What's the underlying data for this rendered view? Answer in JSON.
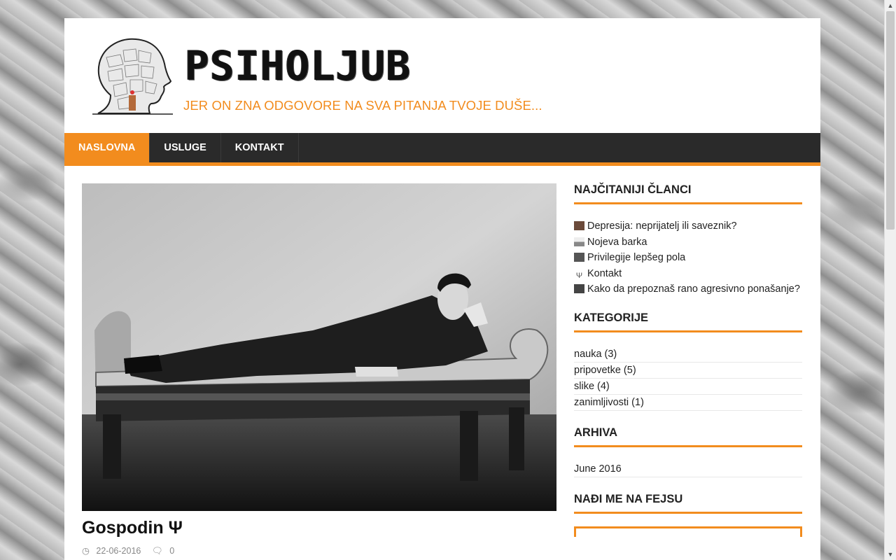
{
  "header": {
    "site_title": "PSIHOLJUB",
    "tagline": "JER ON ZNA ODGOVORE NA SVA PITANJA TVOJE DUŠE..."
  },
  "nav": {
    "items": [
      {
        "label": "NASLOVNA",
        "active": true
      },
      {
        "label": "USLUGE",
        "active": false
      },
      {
        "label": "KONTAKT",
        "active": false
      }
    ]
  },
  "post": {
    "title": "Gospodin Ψ",
    "date": "22-06-2016",
    "comments": "0",
    "icons": {
      "date": "clock-icon",
      "comments": "comment-icon"
    }
  },
  "sidebar": {
    "popular": {
      "title": "NAJČITANIJI ČLANCI",
      "items": [
        "Depresija: neprijatelj ili saveznik?",
        "Nojeva barka",
        "Privilegije lepšeg pola",
        "Kontakt",
        "Kako da prepoznaš rano agresivno ponašanje?"
      ]
    },
    "categories": {
      "title": "KATEGORIJE",
      "items": [
        "nauka (3)",
        "pripovetke (5)",
        "slike (4)",
        "zanimljivosti (1)"
      ]
    },
    "archive": {
      "title": "ARHIVA",
      "items": [
        "June 2016"
      ]
    },
    "facebook": {
      "title": "NAĐI ME NA FEJSU"
    }
  },
  "colors": {
    "accent": "#f28c1e",
    "nav_bg": "#2a2a2a"
  }
}
